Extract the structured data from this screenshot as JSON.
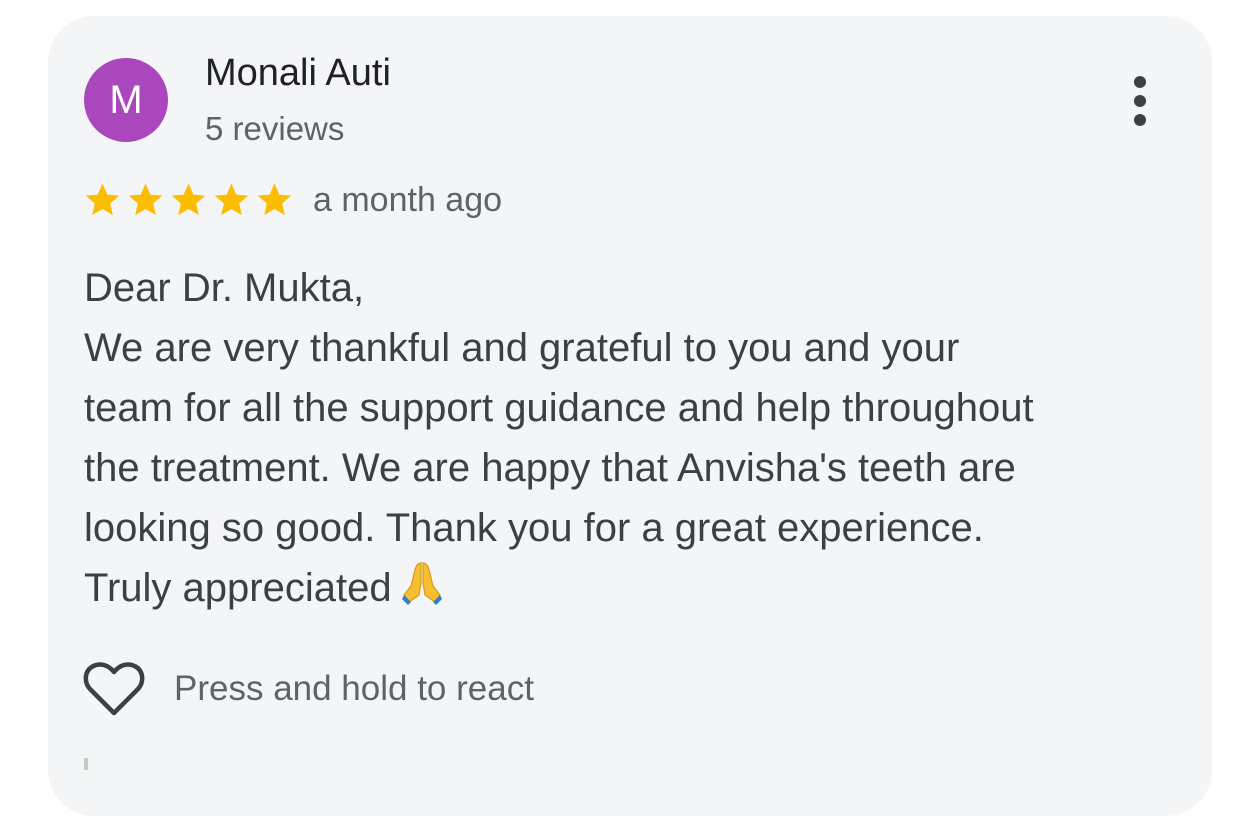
{
  "review": {
    "author": {
      "initial": "M",
      "name": "Monali Auti",
      "review_count": "5 reviews",
      "avatar_color": "#ab47bc"
    },
    "menu_icon": "more-vert-icon",
    "rating": 5,
    "rating_max": 5,
    "star_color": "#fbbc04",
    "date": "a month ago",
    "body_lines": [
      "Dear Dr. Mukta,",
      "We are very thankful and grateful to you and your",
      "team for all the support guidance and help throughout",
      "the treatment. We are happy that Anvisha's teeth are",
      "looking so good. Thank you for a great experience.",
      "Truly appreciated"
    ],
    "body_emoji": "folded-hands-emoji",
    "react": {
      "icon": "heart-outline-icon",
      "label": "Press and hold to react"
    }
  }
}
